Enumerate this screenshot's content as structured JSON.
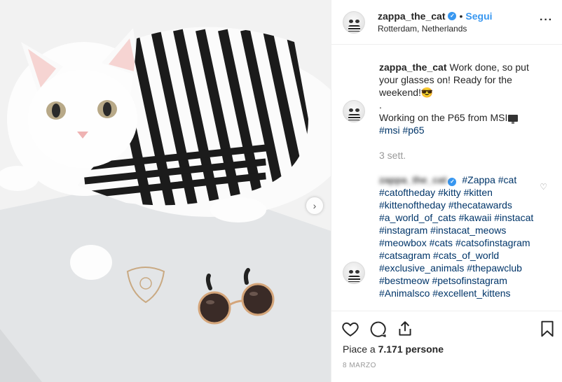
{
  "post": {
    "username": "zappa_the_cat",
    "verified_mark": "✓",
    "follow_label": "Segui",
    "separator": "•",
    "location": "Rotterdam, Netherlands",
    "more_label": "···"
  },
  "caption": {
    "username": "zappa_the_cat",
    "line1": "Work done, so put your glasses on! Ready for the weekend!😎",
    "dot": ".",
    "line2": "Working on the P65 from MSI",
    "tags": [
      "#msi",
      "#p65"
    ],
    "time_ago": "3 sett."
  },
  "comment": {
    "username_blurred": "zappa_the_cat",
    "tags": [
      "#Zappa",
      "#cat",
      "#catoftheday",
      "#kitty",
      "#kitten",
      "#kittenoftheday",
      "#thecatawards",
      "#a_world_of_cats",
      "#kawaii",
      "#instacat",
      "#instagram",
      "#instacat_meows",
      "#meowbox",
      "#cats",
      "#catsofinstagram",
      "#catsagram",
      "#cats_of_world",
      "#exclusive_animals",
      "#thepawclub",
      "#bestmeow",
      "#petsofinstagram",
      "#Animalsco",
      "#excellent_kittens"
    ]
  },
  "actions": {
    "likes_prefix": "Piace a ",
    "likes_count": "7.171",
    "likes_suffix": " persone",
    "date": "8 MARZO"
  },
  "icons": {
    "like": "heart-icon",
    "comment": "comment-bubble-icon",
    "share": "share-icon",
    "save": "bookmark-icon",
    "next": "chevron-right-icon",
    "comment_like": "small-heart-icon"
  },
  "colors": {
    "accent": "#3897f0",
    "hashtag": "#003569",
    "muted": "#999999",
    "text": "#262626"
  }
}
